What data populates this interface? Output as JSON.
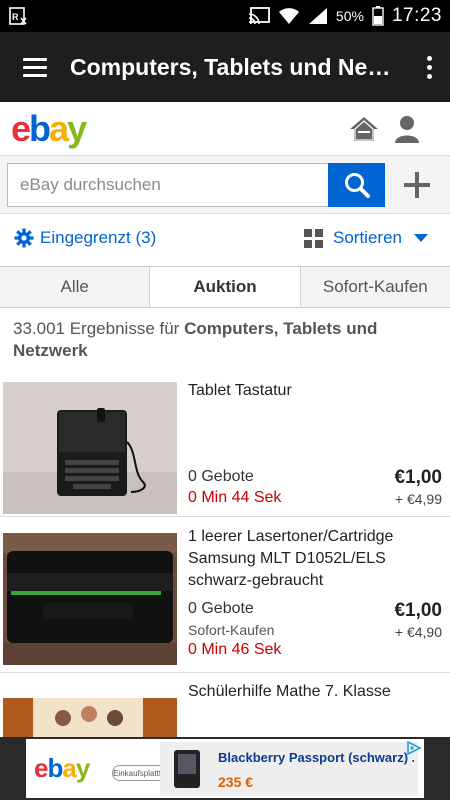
{
  "status_bar": {
    "battery": "50%",
    "time": "17:23"
  },
  "action_bar": {
    "title": "Computers, Tablets und Ne…"
  },
  "header": {
    "logo": {
      "e": "e",
      "b": "b",
      "a": "a",
      "y": "y"
    }
  },
  "search": {
    "placeholder": "eBay durchsuchen",
    "value": ""
  },
  "filter": {
    "refine_label": "Eingegrenzt (3)",
    "sort_label": "Sortieren"
  },
  "tabs": [
    {
      "label": "Alle",
      "active": false
    },
    {
      "label": "Auktion",
      "active": true
    },
    {
      "label": "Sofort-Kaufen",
      "active": false
    }
  ],
  "results": {
    "count_prefix": "33.001 Ergebnisse für ",
    "category": "Computers, Tablets und Netzwerk"
  },
  "listings": [
    {
      "title": "Tablet Tastatur",
      "bids": "0 Gebote",
      "time_left": "0 Min 44 Sek",
      "price": "€1,00",
      "shipping": "+ €4,99"
    },
    {
      "title": "1 leerer Lasertoner/Cartridge Samsung MLT  D1052L/ELS schwarz-gebraucht",
      "bids": "0 Gebote",
      "buy_now": "Sofort-Kaufen",
      "time_left": "0 Min 46 Sek",
      "price": "€1,00",
      "shipping": "+ €4,90"
    },
    {
      "title": "Schülerhilfe Mathe 7. Klasse"
    }
  ],
  "ad": {
    "logo": {
      "e": "e",
      "b": "b",
      "a": "a",
      "y": "y"
    },
    "badge": "Einkaufsplattform",
    "product_title": "Blackberry Passport (schwarz) ...",
    "product_price": "235 €"
  },
  "colors": {
    "accent": "#0064d2",
    "time_left": "#cc0000",
    "action_bar": "#1e1e1e"
  }
}
